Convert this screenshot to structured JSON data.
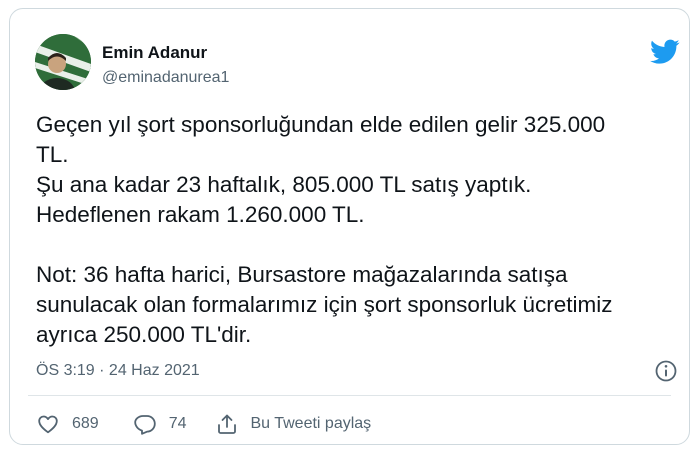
{
  "author": {
    "name": "Emin Adanur",
    "handle": "@eminadanurea1"
  },
  "tweet": {
    "paragraph1": "Geçen yıl şort sponsorluğundan elde edilen gelir 325.000\nTL.\nŞu ana kadar 23 haftalık, 805.000 TL satış yaptık.\nHedeflenen rakam 1.260.000 TL.",
    "paragraph2": "Not: 36 hafta harici, Bursastore mağazalarında satışa\nsunulacak olan formalarımız için şort sponsorluk ücretimiz\nayrıca 250.000 TL'dir."
  },
  "meta": {
    "timestamp": "ÖS 3:19 · 24 Haz 2021"
  },
  "actions": {
    "likes": "689",
    "replies": "74",
    "share_label": "Bu Tweeti paylaş"
  },
  "colors": {
    "twitter_blue": "#1d9bf0",
    "secondary_text": "#536471",
    "border": "#cfd9de"
  },
  "icons": [
    "twitter-bird-icon",
    "info-icon",
    "heart-icon",
    "reply-icon",
    "share-icon"
  ]
}
